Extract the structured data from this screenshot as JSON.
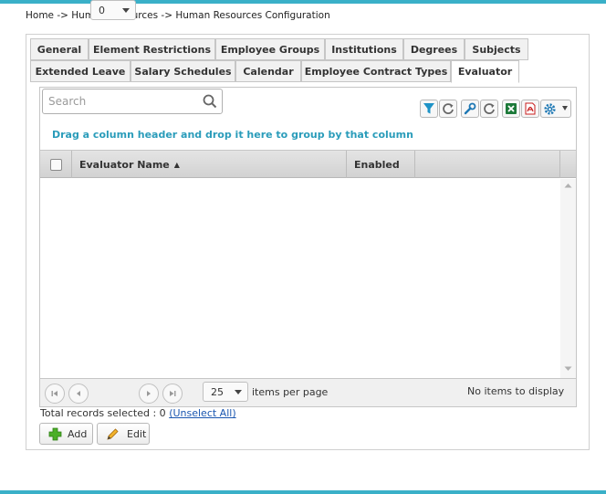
{
  "breadcrumb": "Home -> Human Resources -> Human Resources Configuration",
  "tabs_row1": [
    "General",
    "Element Restrictions",
    "Employee Groups",
    "Institutions",
    "Degrees",
    "Subjects"
  ],
  "tabs_row2": [
    "Extended Leave",
    "Salary Schedules",
    "Calendar",
    "Employee Contract Types",
    "Evaluator"
  ],
  "active_tab": "Evaluator",
  "search": {
    "placeholder": "Search",
    "value": ""
  },
  "toolbar_icons": [
    "filter-icon",
    "refresh-icon",
    "wrench-icon",
    "refresh-icon",
    "excel-icon",
    "pdf-icon",
    "gear-icon"
  ],
  "grid": {
    "group_hint": "Drag a column header and drop it here to group by that column",
    "columns": [
      {
        "label": "Evaluator Name",
        "sort": "asc"
      },
      {
        "label": "Enabled"
      }
    ],
    "sort_indicator": "▲",
    "rows": []
  },
  "pager": {
    "page": "0",
    "page_size": "25",
    "items_per_page_label": "items per page",
    "status": "No items to display"
  },
  "selection": {
    "text": "Total records selected : 0",
    "unselect_label": "(Unselect All)"
  },
  "actions": {
    "add_label": "Add",
    "edit_label": "Edit"
  },
  "colors": {
    "accent": "#3ab0c8",
    "link": "#1a56b0",
    "hint": "#2a9cba"
  }
}
